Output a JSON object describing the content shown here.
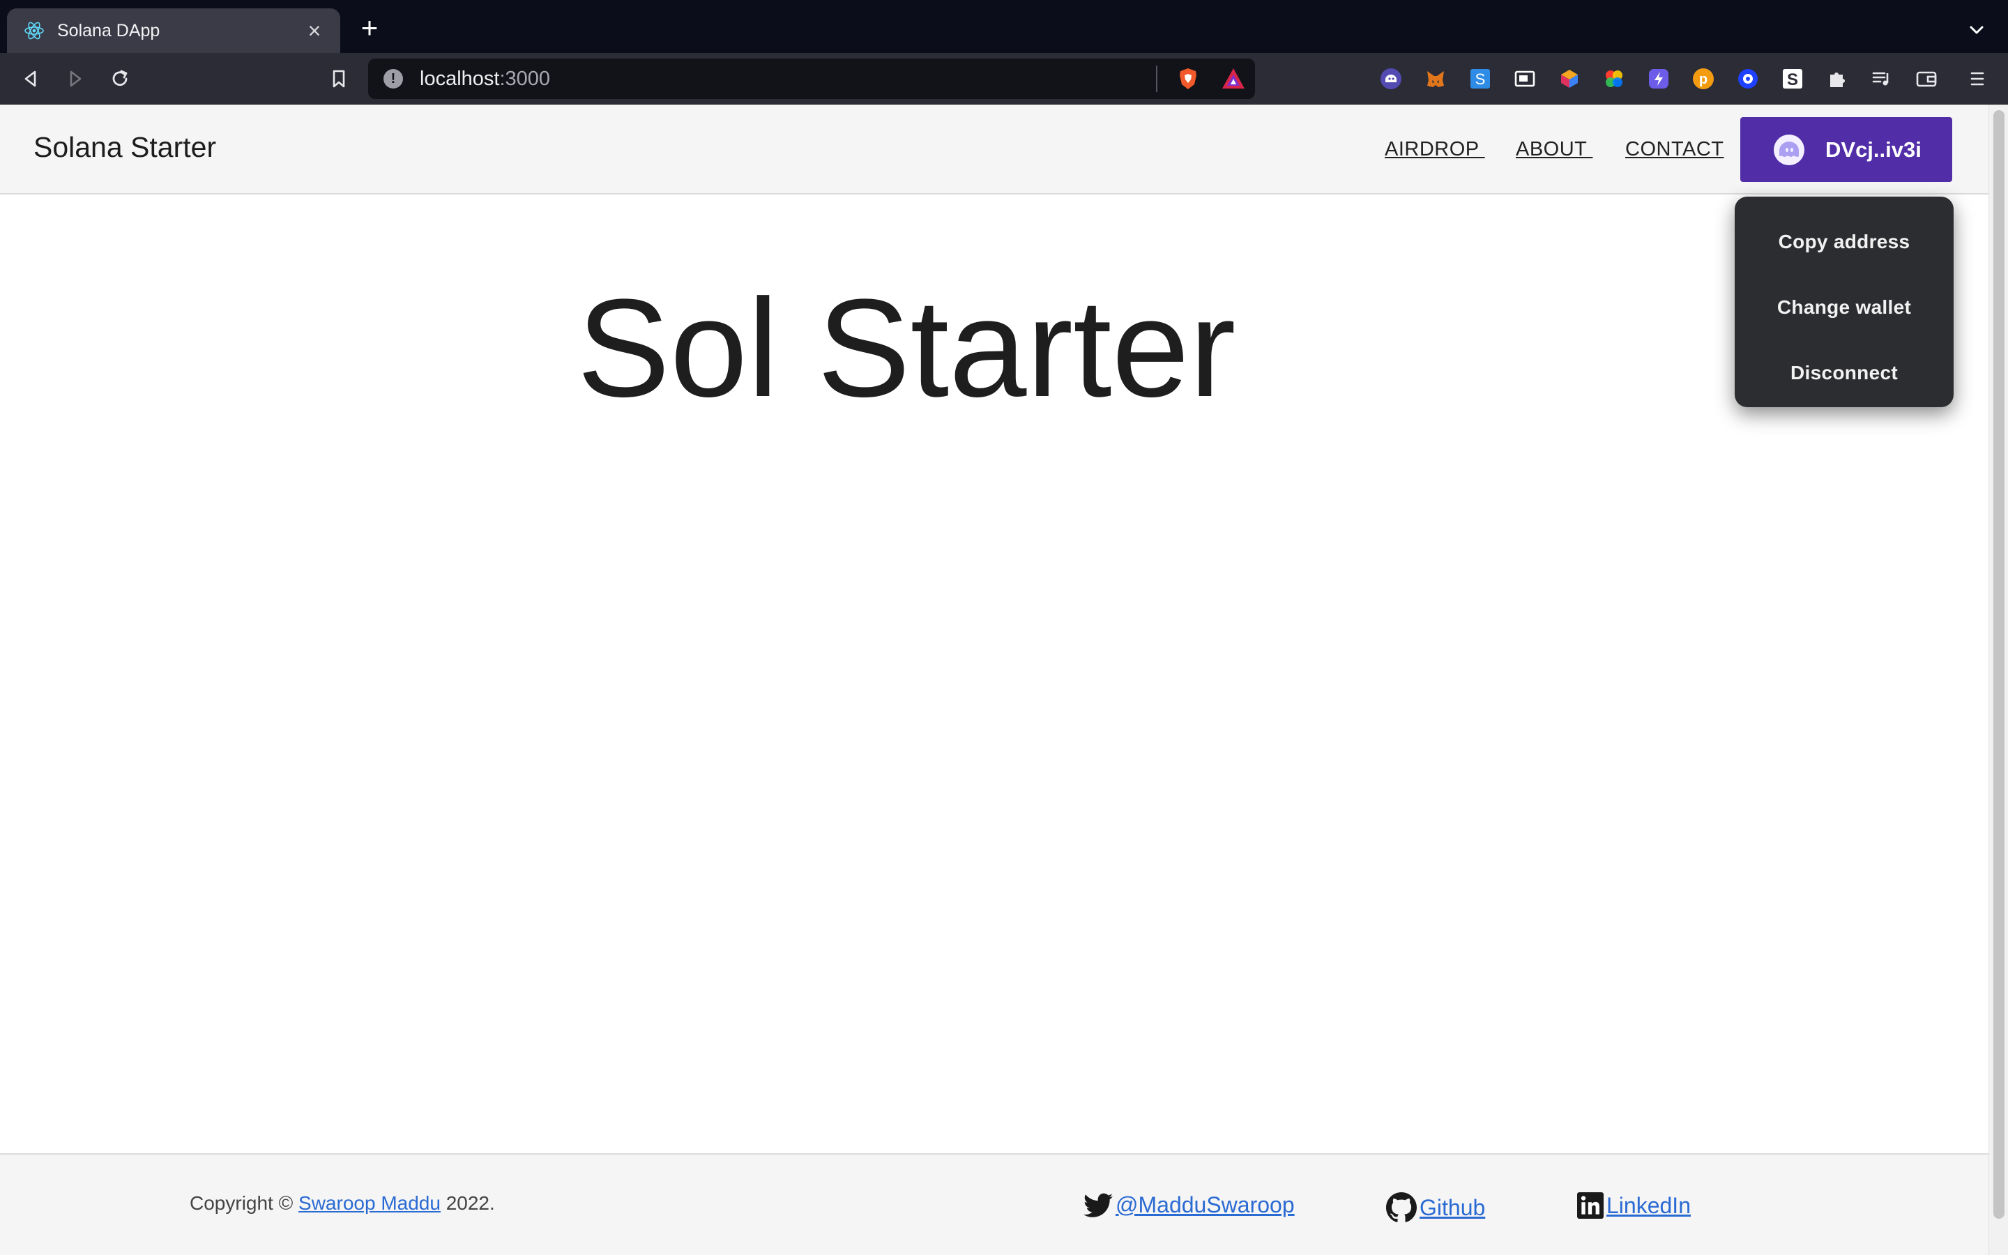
{
  "browser": {
    "tab_title": "Solana DApp",
    "tab_close": "×",
    "new_tab": "+",
    "url_host": "localhost",
    "url_port": ":3000",
    "url_info": "!"
  },
  "header": {
    "brand": "Solana Starter",
    "nav": [
      {
        "label": "AIRDROP "
      },
      {
        "label": "ABOUT "
      },
      {
        "label": "CONTACT"
      }
    ],
    "wallet_label": "DVcj..iv3i"
  },
  "wallet_menu": {
    "items": [
      {
        "label": "Copy address"
      },
      {
        "label": "Change wallet"
      },
      {
        "label": "Disconnect"
      }
    ]
  },
  "main": {
    "title": "Sol Starter"
  },
  "footer": {
    "copyright_prefix": "Copyright © ",
    "author": "Swaroop Maddu",
    "copyright_suffix": " 2022.",
    "twitter": "@MadduSwaroop",
    "github": "Github",
    "linkedin": "LinkedIn"
  },
  "colors": {
    "accent": "#512da8",
    "link": "#2a6ad3",
    "menu_bg": "#2c2d30"
  },
  "icons": [
    "react-icon",
    "back-icon",
    "forward-icon",
    "reload-icon",
    "bookmark-icon",
    "brave-shield-icon",
    "brave-rewards-icon",
    "phantom-icon",
    "metamask-icon",
    "twitter-icon",
    "github-icon",
    "linkedin-icon"
  ]
}
